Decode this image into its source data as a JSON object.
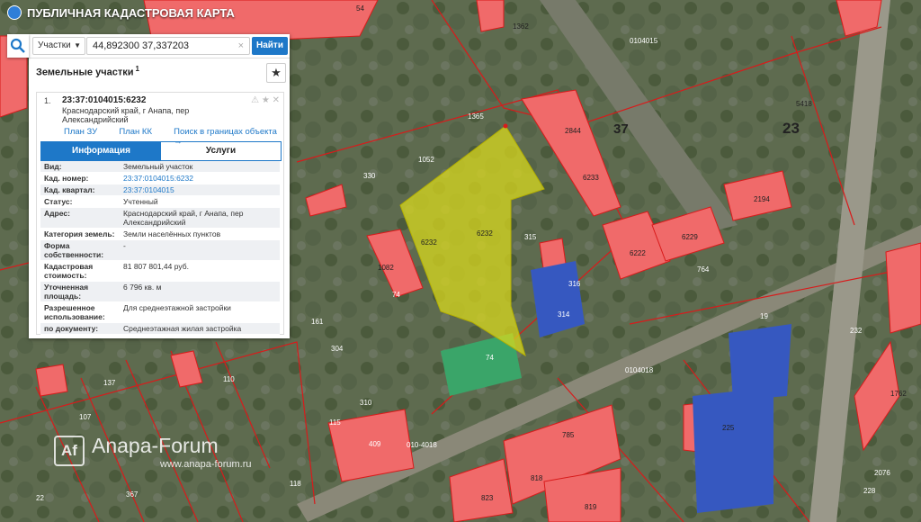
{
  "app": {
    "title": "ПУБЛИЧНАЯ КАДАСТРОВАЯ КАРТА"
  },
  "search": {
    "type_label": "Участки",
    "query": "44,892300 37,337203",
    "find_label": "Найти",
    "clear_symbol": "×"
  },
  "results": {
    "title": "Земельные участки",
    "count": "1"
  },
  "parcel": {
    "index": "1.",
    "cad_number": "23:37:0104015:6232",
    "address": "Краснодарский край, г Анапа, пер Александрийский",
    "links": [
      "План ЗУ →",
      "План КК →",
      "Поиск в границах объекта →"
    ],
    "tabs": [
      "Информация",
      "Услуги"
    ],
    "rows": [
      {
        "k": "Вид:",
        "v": "Земельный участок"
      },
      {
        "k": "Кад. номер:",
        "v": "23:37:0104015:6232"
      },
      {
        "k": "Кад. квартал:",
        "v": "23:37:0104015"
      },
      {
        "k": "Статус:",
        "v": "Учтенный"
      },
      {
        "k": "Адрес:",
        "v": "Краснодарский край, г Анапа, пер Александрийский"
      },
      {
        "k": "Категория земель:",
        "v": "Земли населённых пунктов"
      },
      {
        "k": "Форма собственности:",
        "v": "-"
      },
      {
        "k": "Кадастровая стоимость:",
        "v": "81 807 801,44 руб."
      },
      {
        "k": "Уточненная площадь:",
        "v": "6 796 кв. м"
      },
      {
        "k": "Разрешенное использование:",
        "v": "Для среднеэтажной застройки"
      },
      {
        "k": "по документу:",
        "v": "Среднеэтажная жилая застройка"
      }
    ]
  },
  "map_labels": {
    "quarter_1": "0104015",
    "block_37": "37",
    "block_23": "23",
    "quarter_2": "0104018",
    "quarter_3": "010-4018",
    "parcel_a": "6232",
    "parcel_b": "6232",
    "n1052": "1052",
    "n1365": "1365",
    "n330": "330",
    "n315": "315",
    "n316": "316",
    "n314": "314",
    "n74a": "74",
    "n74b": "74",
    "n1082": "1082",
    "n2844": "2844",
    "n6233": "6233",
    "n6222": "6222",
    "n6229": "6229",
    "n2194": "2194",
    "n5418": "5418",
    "n764": "764",
    "n19": "19",
    "n232": "232",
    "n225": "225",
    "n785": "785",
    "n823": "823",
    "n818": "818",
    "n819": "819",
    "n409": "409",
    "n310": "310",
    "n304": "304",
    "n161": "161",
    "n137": "137",
    "n107": "107",
    "n367": "367",
    "n118": "118",
    "n115": "115",
    "n110": "110",
    "n22": "22",
    "n2076": "2076",
    "n228": "228",
    "n1762": "1762",
    "n54": "54",
    "n1362": "1362"
  },
  "watermark": {
    "logo": "Af",
    "name": "Anapa-Forum",
    "url": "www.anapa-forum.ru"
  },
  "colors": {
    "building": "#f06a6a",
    "boundary": "#d81b1b",
    "selected": "#d8d81e",
    "accent": "#1e78c8"
  }
}
